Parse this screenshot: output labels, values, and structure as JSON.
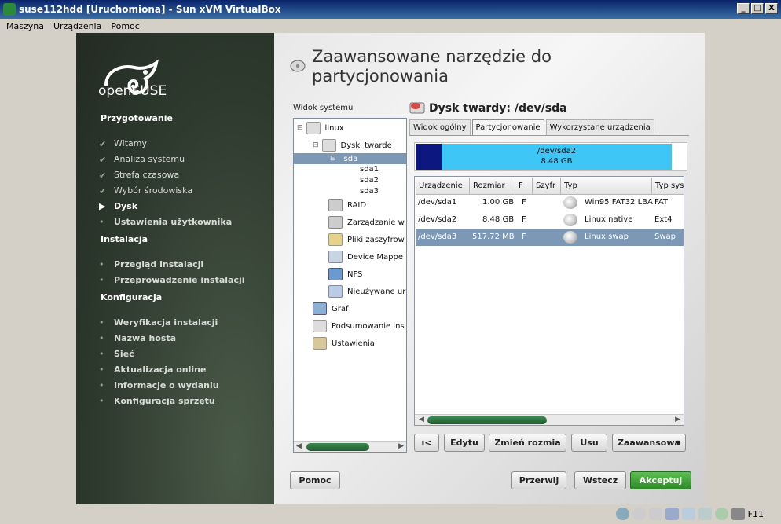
{
  "window": {
    "title": "suse112hdd [Uruchomiona] - Sun xVM VirtualBox",
    "buttons": {
      "min": "_",
      "max": "□",
      "close": "X"
    }
  },
  "menu": [
    "Maszyna",
    "Urządzenia",
    "Pomoc"
  ],
  "sidebar": {
    "logo_text": "openSUSE",
    "sections": [
      {
        "title": "Przygotowanie",
        "steps": [
          {
            "label": "Witamy",
            "state": "done"
          },
          {
            "label": "Analiza systemu",
            "state": "done"
          },
          {
            "label": "Strefa czasowa",
            "state": "done"
          },
          {
            "label": "Wybór środowiska",
            "state": "done"
          },
          {
            "label": "Dysk",
            "state": "current"
          },
          {
            "label": "Ustawienia użytkownika",
            "state": "todo"
          }
        ]
      },
      {
        "title": "Instalacja",
        "steps": [
          {
            "label": "Przegląd instalacji",
            "state": "todo"
          },
          {
            "label": "Przeprowadzenie instalacji",
            "state": "todo"
          }
        ]
      },
      {
        "title": "Konfiguracja",
        "steps": [
          {
            "label": "Weryfikacja instalacji",
            "state": "todo"
          },
          {
            "label": "Nazwa hosta",
            "state": "todo"
          },
          {
            "label": "Sieć",
            "state": "todo"
          },
          {
            "label": "Aktualizacja online",
            "state": "todo"
          },
          {
            "label": "Informacje o wydaniu",
            "state": "todo"
          },
          {
            "label": "Konfiguracja sprzętu",
            "state": "todo"
          }
        ]
      }
    ]
  },
  "main": {
    "title": "Zaawansowane narzędzie do partycjonowania",
    "tree_label": "Widok systemu",
    "tree": {
      "linux": "linux",
      "hard_disks": "Dyski twarde",
      "sda": "sda",
      "sda1": "sda1",
      "sda2": "sda2",
      "sda3": "sda3",
      "raid": "RAID",
      "lvm": "Zarządzanie w",
      "crypt": "Pliki zaszyfrow",
      "dm": "Device Mappe",
      "nfs": "NFS",
      "unused": "Nieużywane ur",
      "graph": "Graf",
      "summary": "Podsumowanie ins",
      "settings": "Ustawienia"
    },
    "disk_title": "Dysk twardy: /dev/sda",
    "tabs": [
      "Widok ogólny",
      "Partycjonowanie",
      "Wykorzystane urządzenia"
    ],
    "active_tab": 1,
    "bar": {
      "device": "/dev/sda2",
      "size": "8.48 GB",
      "colors": {
        "sda1": "#0d1780",
        "sda2": "#3ec6f6",
        "free": "#ffffff"
      }
    },
    "table": {
      "headers": [
        "Urządzenie",
        "Rozmiar",
        "F",
        "Szyfr",
        "Typ",
        "Typ syst"
      ],
      "rows": [
        [
          "/dev/sda1",
          "1.00 GB",
          "F",
          "",
          "Win95 FAT32 LBA",
          "FAT"
        ],
        [
          "/dev/sda2",
          "8.48 GB",
          "F",
          "",
          "Linux native",
          "Ext4"
        ],
        [
          "/dev/sda3",
          "517.72 MB",
          "F",
          "",
          "Linux swap",
          "Swap"
        ]
      ],
      "selected_row": 2
    },
    "actions": [
      "ı<",
      "Edytu",
      "Zmień rozmia",
      "Usu",
      "Zaawansowa"
    ],
    "footer": {
      "help": "Pomoc",
      "abort": "Przerwij",
      "back": "Wstecz",
      "accept": "Akceptuj"
    }
  },
  "statusbar": {
    "host_key": "F11"
  }
}
